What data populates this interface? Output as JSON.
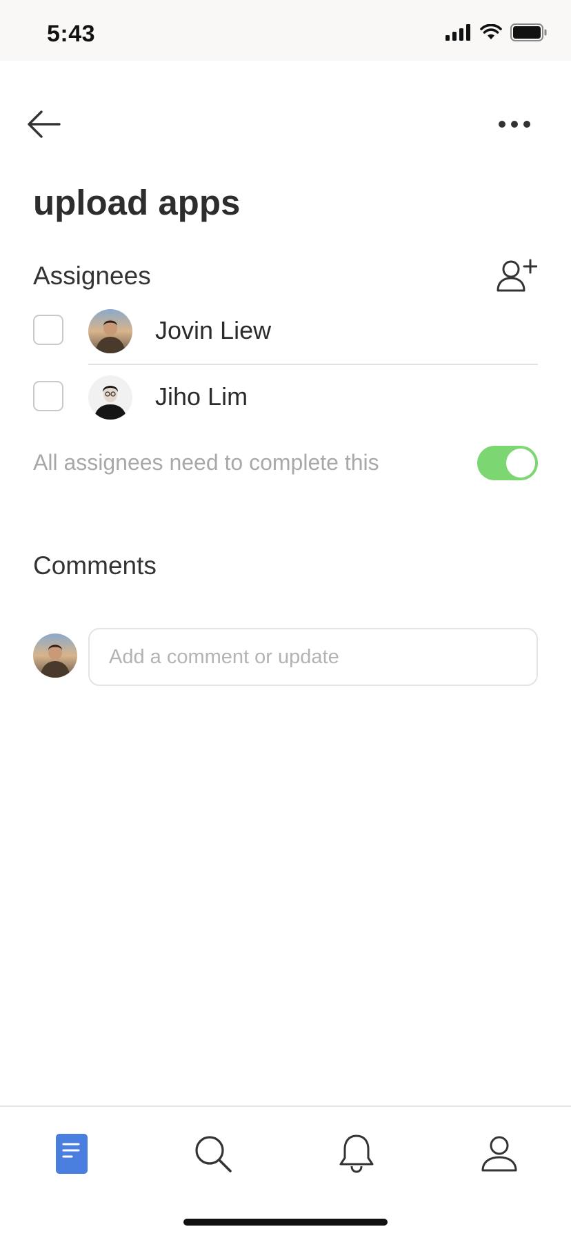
{
  "status_bar": {
    "time": "5:43",
    "icons": [
      "signal-icon",
      "wifi-icon",
      "battery-icon"
    ]
  },
  "header": {
    "back_icon": "arrow-left-icon",
    "more_icon": "ellipsis-icon"
  },
  "task": {
    "title": "upload apps"
  },
  "assignees": {
    "heading": "Assignees",
    "add_icon": "add-user-icon",
    "items": [
      {
        "name": "Jovin Liew",
        "checked": false
      },
      {
        "name": "Jiho Lim",
        "checked": false
      }
    ],
    "require_all_label": "All assignees need to complete this",
    "require_all_enabled": true
  },
  "comments": {
    "heading": "Comments",
    "input_placeholder": "Add a comment or update",
    "input_value": ""
  },
  "tab_bar": {
    "tabs": [
      {
        "icon": "document-icon",
        "active": true
      },
      {
        "icon": "search-icon",
        "active": false
      },
      {
        "icon": "bell-icon",
        "active": false
      },
      {
        "icon": "person-icon",
        "active": false
      }
    ]
  },
  "colors": {
    "accent_blue": "#4a7fe0",
    "toggle_on": "#7cd672",
    "status_bar_bg": "#f9f8f7"
  }
}
